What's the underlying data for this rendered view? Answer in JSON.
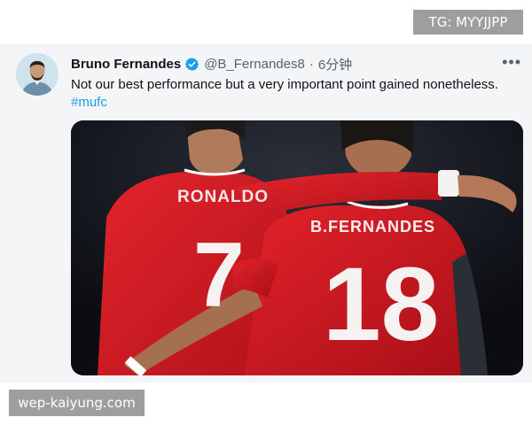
{
  "watermark_top": "TG: MYYJJPP",
  "watermark_bottom": "wep-kaiyung.com",
  "tweet": {
    "author_name": "Bruno Fernandes",
    "handle": "@B_Fernandes8",
    "separator": "·",
    "time": "6分钟",
    "more_icon": "more-dots-icon",
    "verified_icon": "verified-badge-icon",
    "text": "Not our best performance but a very important point gained nonetheless.",
    "hashtag": "#mufc",
    "accent_color": "#1d9bf0",
    "photo": {
      "left_player_name": "RONALDO",
      "left_player_number": "7",
      "right_player_name": "B.FERNANDES",
      "right_player_number": "18",
      "shirt_color": "#d7171f"
    }
  }
}
